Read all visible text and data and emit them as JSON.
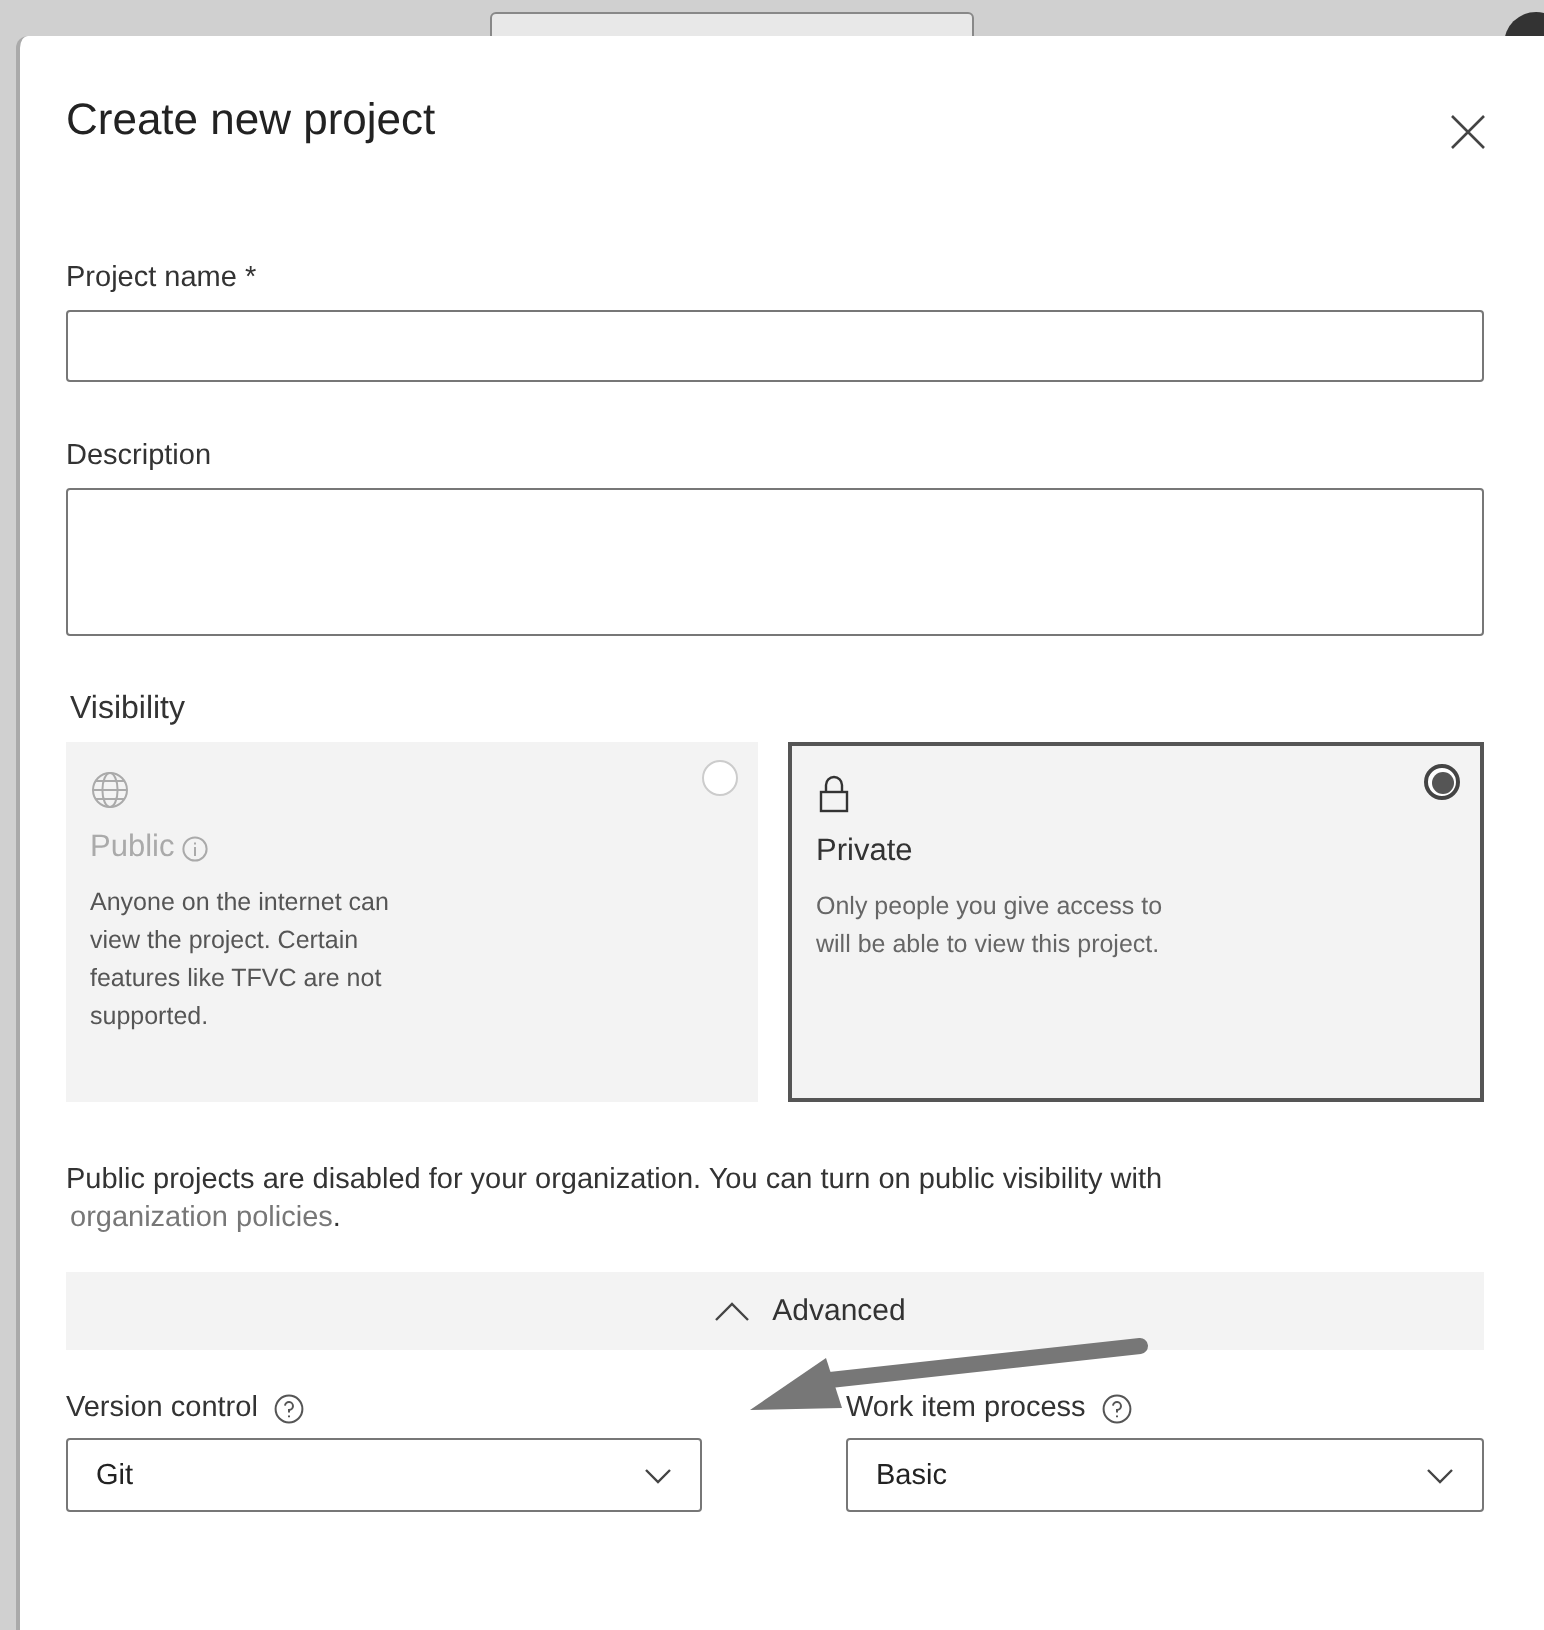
{
  "dialog": {
    "title": "Create new project"
  },
  "fields": [
    {
      "label": "Project name *",
      "kind": "input"
    },
    {
      "label": "Description",
      "kind": "textarea"
    }
  ],
  "visibility": {
    "label": "Visibility",
    "options": [
      {
        "title": "Public",
        "description": "Anyone on the internet can view the project. Certain features like TFVC are not supported.",
        "selected": false,
        "disabled": true,
        "has_info": true
      },
      {
        "title": "Private",
        "description": "Only people you give access to will be able to view this project.",
        "selected": true,
        "disabled": false,
        "has_info": false
      }
    ]
  },
  "notice": {
    "text": "Public projects are disabled for your organization. You can turn on public visibility with",
    "link": "organization policies",
    "end": "."
  },
  "advanced": {
    "label": "Advanced",
    "expanded": true
  },
  "selects": [
    {
      "label": "Version control",
      "value": "Git"
    },
    {
      "label": "Work item process",
      "value": "Basic"
    }
  ]
}
